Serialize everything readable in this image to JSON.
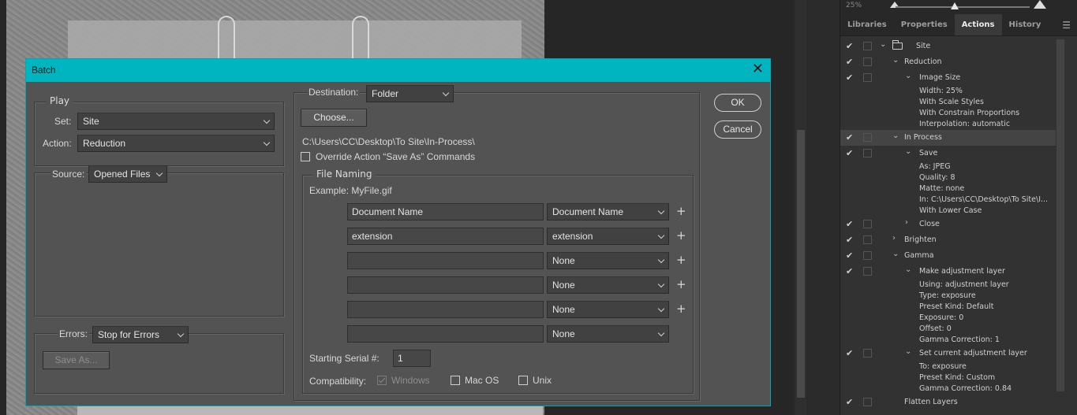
{
  "panel": {
    "zoom_label": "25%",
    "tabs": [
      "Libraries",
      "Properties",
      "Actions",
      "History"
    ],
    "active_tab": "Actions",
    "actions": [
      {
        "label": "Site",
        "type": "set",
        "indent": 0
      },
      {
        "label": "Reduction",
        "type": "action",
        "indent": 1
      },
      {
        "label": "Image Size",
        "type": "step",
        "indent": 2
      },
      {
        "label": "Width: 25%",
        "type": "detail"
      },
      {
        "label": "With Scale Styles",
        "type": "detail"
      },
      {
        "label": "With Constrain Proportions",
        "type": "detail"
      },
      {
        "label": "Interpolation: automatic",
        "type": "detail"
      },
      {
        "label": "In Process",
        "type": "action",
        "indent": 1
      },
      {
        "label": "Save",
        "type": "step",
        "indent": 2
      },
      {
        "label": "As: JPEG",
        "type": "detail"
      },
      {
        "label": "Quality: 8",
        "type": "detail"
      },
      {
        "label": "Matte: none",
        "type": "detail"
      },
      {
        "label": "In: C:\\Users\\CC\\Desktop\\To Site\\I...",
        "type": "detail"
      },
      {
        "label": "With Lower Case",
        "type": "detail"
      },
      {
        "label": "Close",
        "type": "step",
        "indent": 2
      },
      {
        "label": "Brighten",
        "type": "action",
        "indent": 1
      },
      {
        "label": "Gamma",
        "type": "action",
        "indent": 1
      },
      {
        "label": "Make adjustment layer",
        "type": "step",
        "indent": 2
      },
      {
        "label": "Using: adjustment layer",
        "type": "detail"
      },
      {
        "label": "Type: exposure",
        "type": "detail"
      },
      {
        "label": "Preset Kind: Default",
        "type": "detail"
      },
      {
        "label": "Exposure: 0",
        "type": "detail"
      },
      {
        "label": "Offset: 0",
        "type": "detail"
      },
      {
        "label": "Gamma Correction: 1",
        "type": "detail"
      },
      {
        "label": "Set current adjustment layer",
        "type": "step",
        "indent": 2
      },
      {
        "label": "To: exposure",
        "type": "detail"
      },
      {
        "label": "Preset Kind: Custom",
        "type": "detail"
      },
      {
        "label": "Gamma Correction: 0.84",
        "type": "detail"
      },
      {
        "label": "Flatten Layers",
        "type": "action",
        "indent": 1
      }
    ]
  },
  "dialog": {
    "title": "Batch",
    "close_glyph": "✕",
    "ok_label": "OK",
    "cancel_label": "Cancel",
    "play": {
      "group_label": "Play",
      "set_label": "Set:",
      "set_value": "Site",
      "action_label": "Action:",
      "action_value": "Reduction"
    },
    "source": {
      "label": "Source:",
      "value": "Opened Files"
    },
    "errors": {
      "label": "Errors:",
      "value": "Stop for Errors",
      "save_as_label": "Save As..."
    },
    "destination": {
      "label": "Destination:",
      "value": "Folder",
      "choose_label": "Choose...",
      "path": "C:\\Users\\CC\\Desktop\\To Site\\In-Process\\",
      "override_label": "Override Action “Save As” Commands",
      "override_checked": false
    },
    "file_naming": {
      "group_label": "File Naming",
      "example": "Example: MyFile.gif",
      "rows": [
        {
          "text": "Document Name",
          "select": "Document Name",
          "plus": true
        },
        {
          "text": "extension",
          "select": "extension",
          "plus": true
        },
        {
          "text": "",
          "select": "None",
          "plus": true
        },
        {
          "text": "",
          "select": "None",
          "plus": true
        },
        {
          "text": "",
          "select": "None",
          "plus": true
        },
        {
          "text": "",
          "select": "None",
          "plus": false
        }
      ],
      "serial_label": "Starting Serial #:",
      "serial_value": "1",
      "compat_label": "Compatibility:",
      "compat_windows": "Windows",
      "compat_macos": "Mac OS",
      "compat_unix": "Unix"
    }
  }
}
